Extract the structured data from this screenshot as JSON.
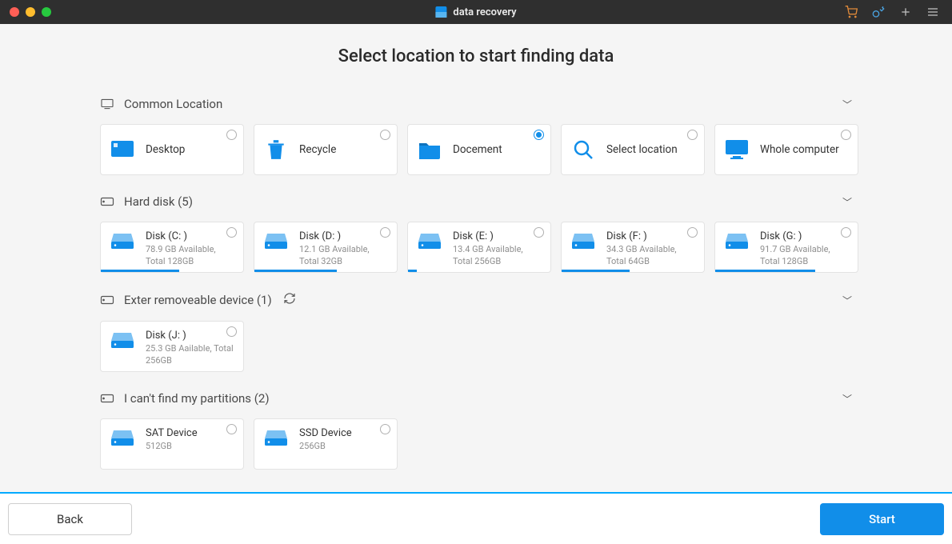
{
  "app": {
    "title": "data recovery"
  },
  "page": {
    "heading": "Select location to  start finding data"
  },
  "sections": {
    "common": {
      "title": "Common Location",
      "items": [
        {
          "label": "Desktop",
          "icon": "desktop-icon",
          "selected": false
        },
        {
          "label": "Recycle",
          "icon": "trash-icon",
          "selected": false
        },
        {
          "label": "Docement",
          "icon": "folder-icon",
          "selected": true
        },
        {
          "label": "Select location",
          "icon": "search-icon",
          "selected": false
        },
        {
          "label": "Whole computer",
          "icon": "monitor-icon",
          "selected": false
        }
      ]
    },
    "hard": {
      "title": "Hard disk (5)",
      "items": [
        {
          "name": "Disk (C: )",
          "info": "78.9 GB Available, Total 128GB",
          "fill": 55
        },
        {
          "name": "Disk (D: )",
          "info": "12.1 GB Available, Total 32GB",
          "fill": 58
        },
        {
          "name": "Disk (E: )",
          "info": "13.4 GB Available, Total 256GB",
          "fill": 6
        },
        {
          "name": "Disk (F: )",
          "info": "34.3 GB Available, Total 64GB",
          "fill": 48
        },
        {
          "name": "Disk (G: )",
          "info": "91.7 GB Available, Total 128GB",
          "fill": 70
        }
      ]
    },
    "ext": {
      "title": "Exter removeable device (1)",
      "items": [
        {
          "name": "Disk (J: )",
          "info": "25.3 GB Aailable, Total 256GB"
        }
      ]
    },
    "lost": {
      "title": "I can't find my partitions (2)",
      "items": [
        {
          "name": "SAT Device",
          "info": "512GB"
        },
        {
          "name": "SSD Device",
          "info": "256GB"
        }
      ]
    }
  },
  "footer": {
    "back": "Back",
    "start": "Start"
  },
  "colors": {
    "accent": "#118ee9"
  }
}
